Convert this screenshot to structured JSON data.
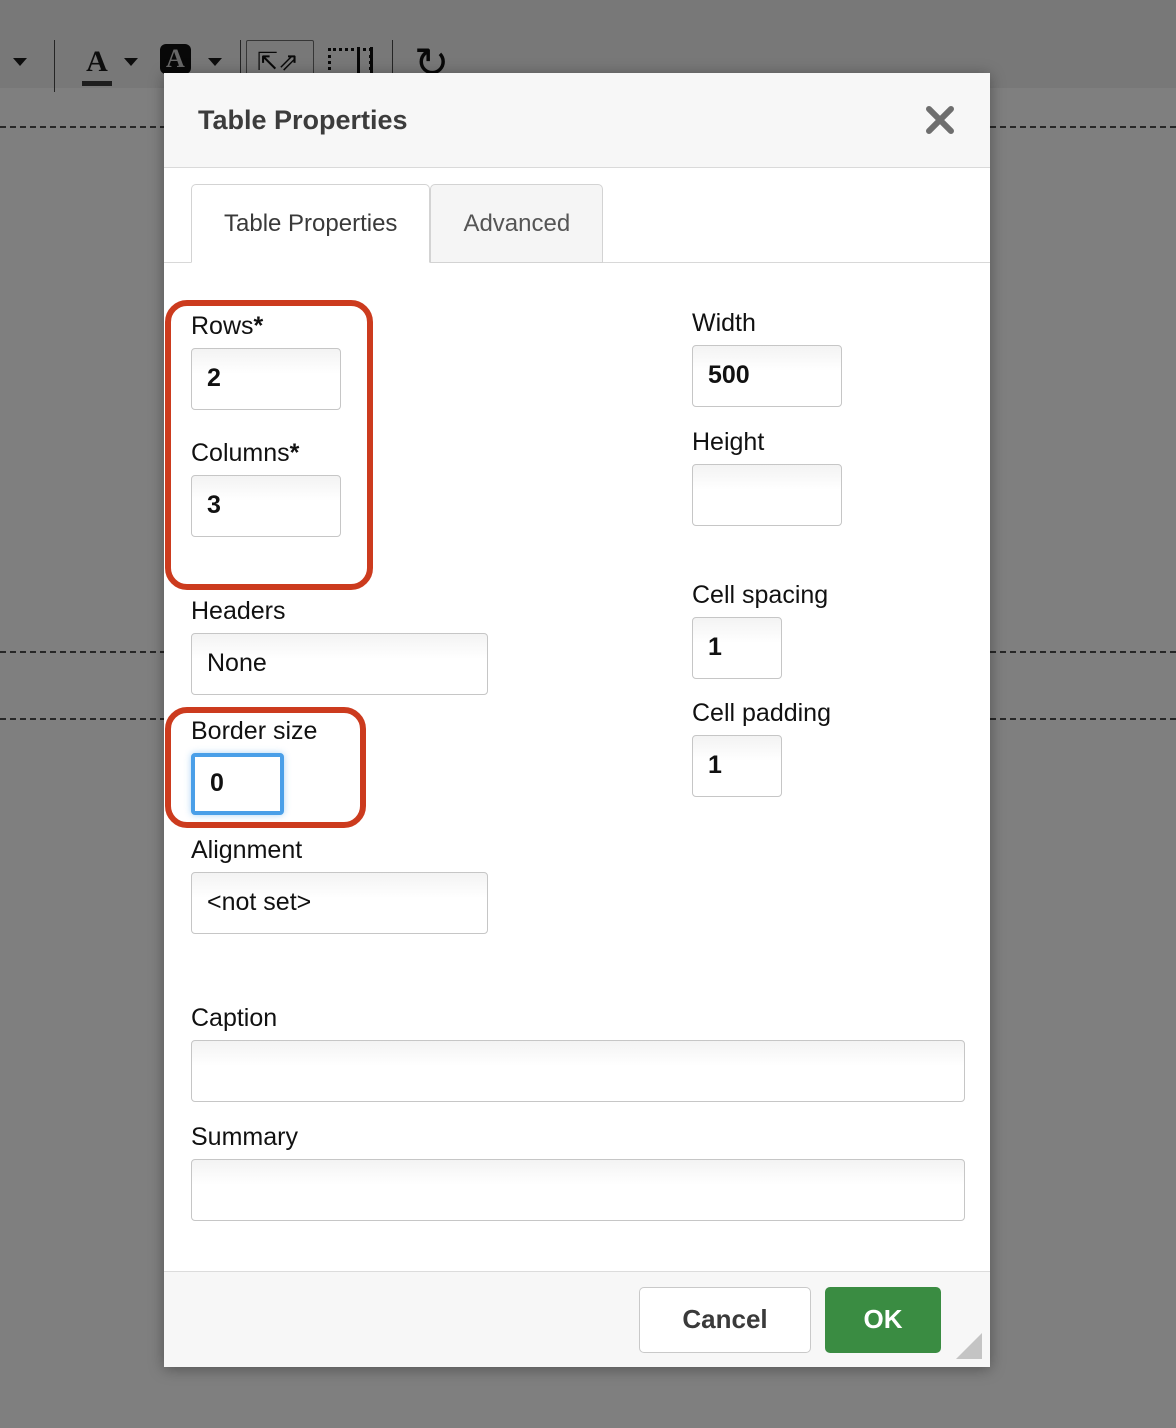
{
  "dialog": {
    "title": "Table Properties",
    "close_icon": "close-x-icon",
    "tabs": [
      {
        "label": "Table Properties",
        "active": true
      },
      {
        "label": "Advanced",
        "active": false
      }
    ],
    "fields": {
      "rows": {
        "label": "Rows",
        "required_mark": "*",
        "value": "2"
      },
      "columns": {
        "label": "Columns",
        "required_mark": "*",
        "value": "3"
      },
      "headers": {
        "label": "Headers",
        "value": "None"
      },
      "border_size": {
        "label": "Border size",
        "value": "0",
        "focused": true
      },
      "alignment": {
        "label": "Alignment",
        "value": "<not set>"
      },
      "width": {
        "label": "Width",
        "value": "500"
      },
      "height": {
        "label": "Height",
        "value": ""
      },
      "cell_spacing": {
        "label": "Cell spacing",
        "value": "1"
      },
      "cell_padding": {
        "label": "Cell padding",
        "value": "1"
      },
      "caption": {
        "label": "Caption",
        "value": ""
      },
      "summary": {
        "label": "Summary",
        "value": ""
      }
    },
    "footer": {
      "cancel_label": "Cancel",
      "ok_label": "OK",
      "resize_grip": "resize-grip-icon"
    }
  },
  "annotations": {
    "color": "#cc3b1e",
    "focus_color": "#4a9fe8",
    "regions": [
      {
        "name": "rows-columns-highlight"
      },
      {
        "name": "border-size-highlight"
      }
    ]
  },
  "colors": {
    "ok_button": "#3a8c42",
    "annotation_red": "#cc3b1e",
    "focus_blue": "#4a9fe8",
    "header_bg": "#f7f7f7",
    "overlay": "rgba(0,0,0,0.5)"
  },
  "toolbar": {
    "icons": [
      "caret-down-icon",
      "text-color-a-icon",
      "caret-down-icon",
      "highlight-color-a-icon",
      "caret-down-icon",
      "maximize-icon",
      "show-blocks-icon",
      "undo-icon",
      "code-icon",
      "align-left-icon",
      "align-center-icon",
      "align-right-icon",
      "justify-icon",
      "indent-icon",
      "numbered-list-icon",
      "anchor-icon",
      "unlink-icon",
      "image-icon",
      "table-icon",
      "horizontal-rule-icon",
      "smiley-icon"
    ]
  }
}
